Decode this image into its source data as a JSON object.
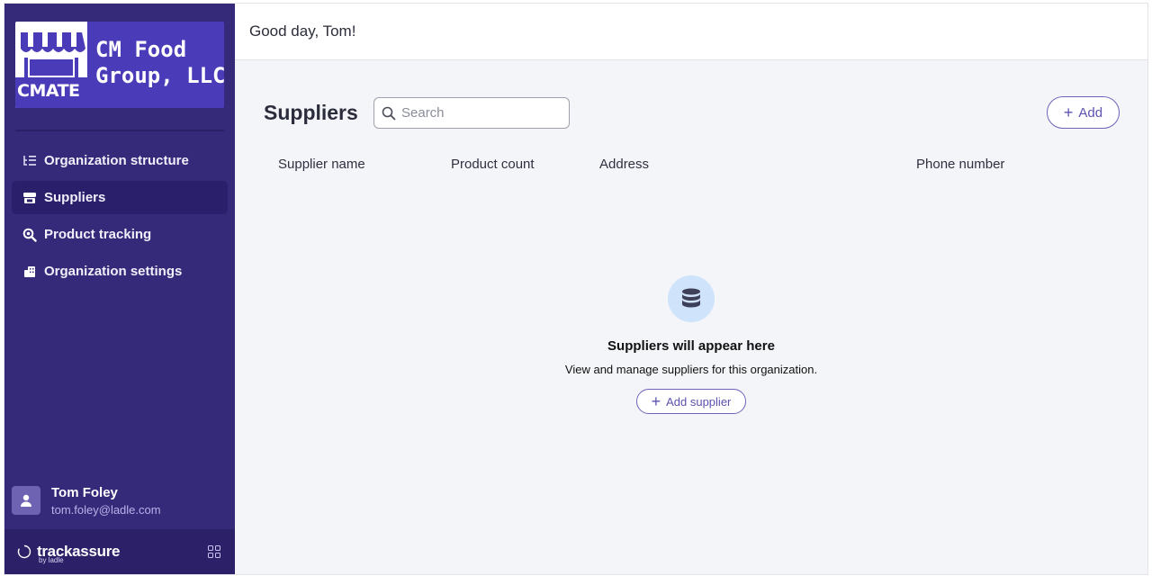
{
  "org": {
    "logo_badge": "CMATE",
    "name_line1": "CM Food",
    "name_line2": "Group, LLC"
  },
  "sidebar": {
    "items": [
      {
        "label": "Organization structure",
        "icon": "list-tree-icon",
        "active": false
      },
      {
        "label": "Suppliers",
        "icon": "storefront-icon",
        "active": true
      },
      {
        "label": "Product tracking",
        "icon": "search-magnify-icon",
        "active": false
      },
      {
        "label": "Organization settings",
        "icon": "building-icon",
        "active": false
      }
    ]
  },
  "user": {
    "name": "Tom Foley",
    "email": "tom.foley@ladle.com"
  },
  "brand": {
    "name": "trackassure",
    "by": "by ladle"
  },
  "header": {
    "greeting": "Good day, Tom!"
  },
  "page": {
    "title": "Suppliers",
    "search_placeholder": "Search",
    "add_label": "Add"
  },
  "table": {
    "columns": [
      "Supplier name",
      "Product count",
      "Address",
      "Phone number"
    ]
  },
  "empty_state": {
    "icon": "database-icon",
    "title": "Suppliers will appear here",
    "description": "View and manage suppliers for this organization.",
    "button_label": "Add supplier"
  },
  "colors": {
    "sidebar_bg": "#35297a",
    "accent": "#5c52b0",
    "logo_bg": "#4a3cb8"
  }
}
